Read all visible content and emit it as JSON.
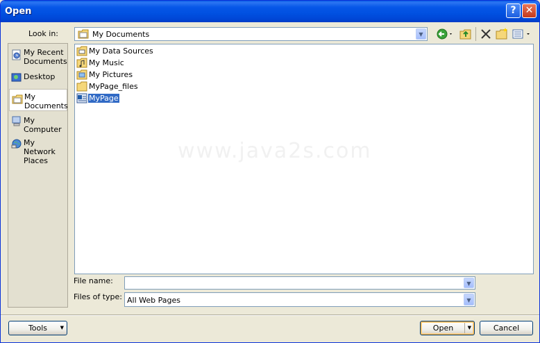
{
  "window": {
    "title": "Open",
    "help_glyph": "?",
    "close_glyph": "✕"
  },
  "lookin": {
    "label": "Look in:",
    "value": "My Documents",
    "icon": "my-documents-icon"
  },
  "toolbar": {
    "back_icon": "back-arrow-icon",
    "up_icon": "up-one-level-icon",
    "delete_icon": "delete-icon",
    "new_folder_icon": "new-folder-icon",
    "views_icon": "views-icon"
  },
  "places": [
    {
      "label": "My Recent Documents",
      "icon": "recent-documents-icon"
    },
    {
      "label": "Desktop",
      "icon": "desktop-icon"
    },
    {
      "label": "My Documents",
      "icon": "my-documents-icon",
      "selected": true
    },
    {
      "label": "My Computer",
      "icon": "my-computer-icon"
    },
    {
      "label": "My Network Places",
      "icon": "network-places-icon"
    }
  ],
  "files": [
    {
      "name": "My Data Sources",
      "icon": "data-sources-folder-icon"
    },
    {
      "name": "My Music",
      "icon": "music-folder-icon"
    },
    {
      "name": "My Pictures",
      "icon": "pictures-folder-icon"
    },
    {
      "name": "MyPage_files",
      "icon": "folder-icon"
    },
    {
      "name": "MyPage",
      "icon": "web-page-icon",
      "selected": true
    }
  ],
  "watermark": "www.java2s.com",
  "filename": {
    "label": "File name:",
    "value": ""
  },
  "filetype": {
    "label": "Files of type:",
    "value": "All Web Pages"
  },
  "buttons": {
    "tools": "Tools",
    "open": "Open",
    "cancel": "Cancel"
  },
  "colors": {
    "title_bar": "#0054e3",
    "selection": "#316ac5",
    "dialog_bg": "#ece9d8"
  }
}
